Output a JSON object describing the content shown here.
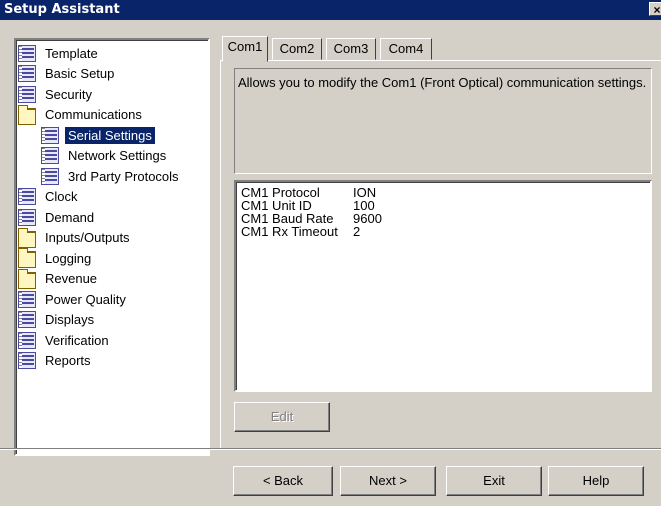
{
  "window": {
    "title": "Setup Assistant",
    "close_glyph": "×"
  },
  "tree": {
    "items": [
      {
        "label": "Template",
        "icon": "document-icon",
        "level": 0,
        "selected": false
      },
      {
        "label": "Basic Setup",
        "icon": "document-icon",
        "level": 0,
        "selected": false
      },
      {
        "label": "Security",
        "icon": "document-icon",
        "level": 0,
        "selected": false
      },
      {
        "label": "Communications",
        "icon": "folder-icon",
        "level": 0,
        "selected": false
      },
      {
        "label": "Serial Settings",
        "icon": "document-icon",
        "level": 1,
        "selected": true
      },
      {
        "label": "Network Settings",
        "icon": "document-icon",
        "level": 1,
        "selected": false
      },
      {
        "label": "3rd Party Protocols",
        "icon": "document-icon",
        "level": 1,
        "selected": false
      },
      {
        "label": "Clock",
        "icon": "document-icon",
        "level": 0,
        "selected": false
      },
      {
        "label": "Demand",
        "icon": "document-icon",
        "level": 0,
        "selected": false
      },
      {
        "label": "Inputs/Outputs",
        "icon": "folder-icon",
        "level": 0,
        "selected": false
      },
      {
        "label": "Logging",
        "icon": "folder-icon",
        "level": 0,
        "selected": false
      },
      {
        "label": "Revenue",
        "icon": "folder-icon",
        "level": 0,
        "selected": false
      },
      {
        "label": "Power Quality",
        "icon": "document-icon",
        "level": 0,
        "selected": false
      },
      {
        "label": "Displays",
        "icon": "document-icon",
        "level": 0,
        "selected": false
      },
      {
        "label": "Verification",
        "icon": "document-icon",
        "level": 0,
        "selected": false
      },
      {
        "label": "Reports",
        "icon": "document-icon",
        "level": 0,
        "selected": false
      }
    ]
  },
  "tabs": [
    {
      "label": "Com1",
      "active": true
    },
    {
      "label": "Com2",
      "active": false
    },
    {
      "label": "Com3",
      "active": false
    },
    {
      "label": "Com4",
      "active": false
    }
  ],
  "description": "Allows you to modify the Com1 (Front Optical) communication settings.",
  "settings": {
    "rows": [
      {
        "name": "CM1 Protocol",
        "value": "ION"
      },
      {
        "name": "CM1 Unit ID",
        "value": "100"
      },
      {
        "name": "CM1 Baud Rate",
        "value": "9600"
      },
      {
        "name": "CM1 Rx Timeout",
        "value": "2"
      }
    ]
  },
  "buttons": {
    "edit": "Edit",
    "back": "< Back",
    "next": "Next >",
    "exit": "Exit",
    "help": "Help"
  }
}
